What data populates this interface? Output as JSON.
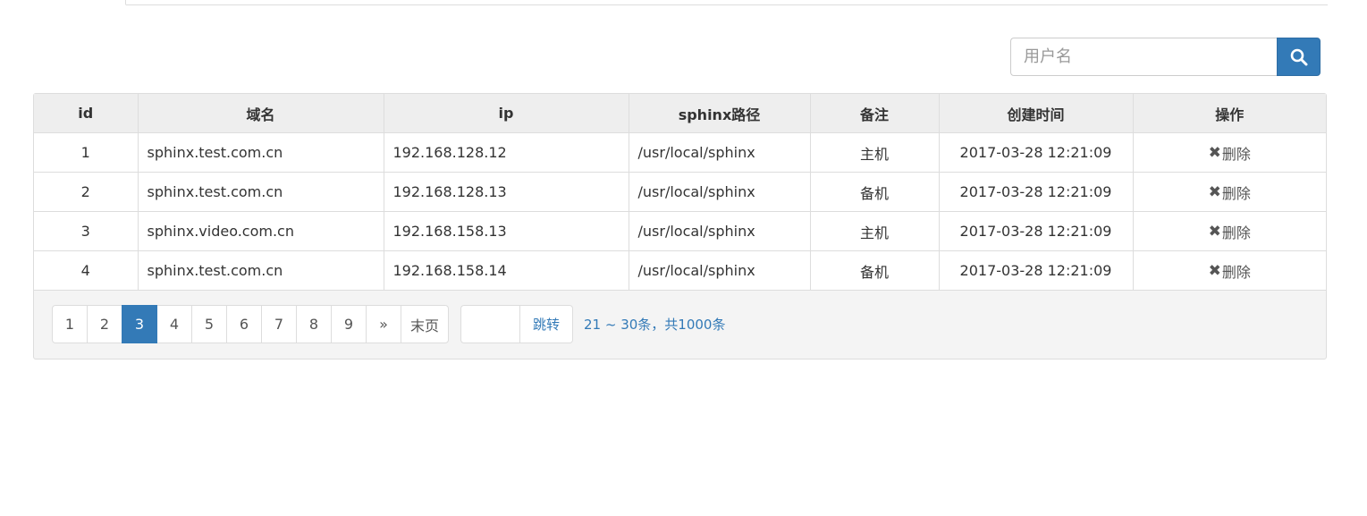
{
  "search": {
    "placeholder": "用户名",
    "button_icon": "search-icon"
  },
  "table": {
    "columns": [
      "id",
      "域名",
      "ip",
      "sphinx路径",
      "备注",
      "创建时间",
      "操作"
    ],
    "rows": [
      {
        "id": "1",
        "domain": "sphinx.test.com.cn",
        "ip": "192.168.128.12",
        "path": "/usr/local/sphinx",
        "note": "主机",
        "created": "2017-03-28 12:21:09",
        "action": "删除"
      },
      {
        "id": "2",
        "domain": "sphinx.test.com.cn",
        "ip": "192.168.128.13",
        "path": "/usr/local/sphinx",
        "note": "备机",
        "created": "2017-03-28 12:21:09",
        "action": "删除"
      },
      {
        "id": "3",
        "domain": "sphinx.video.com.cn",
        "ip": "192.168.158.13",
        "path": "/usr/local/sphinx",
        "note": "主机",
        "created": "2017-03-28 12:21:09",
        "action": "删除"
      },
      {
        "id": "4",
        "domain": "sphinx.test.com.cn",
        "ip": "192.168.158.14",
        "path": "/usr/local/sphinx",
        "note": "备机",
        "created": "2017-03-28 12:21:09",
        "action": "删除"
      }
    ],
    "delete_icon": "close-icon"
  },
  "pagination": {
    "pages": [
      "1",
      "2",
      "3",
      "4",
      "5",
      "6",
      "7",
      "8",
      "9",
      "»",
      "末页"
    ],
    "active_page": "3",
    "jump_value": "",
    "jump_button": "跳转",
    "info": "21 ~ 30条，共1000条"
  },
  "colors": {
    "primary": "#337ab7",
    "header_bg": "#eeeeee",
    "border": "#dddddd"
  }
}
